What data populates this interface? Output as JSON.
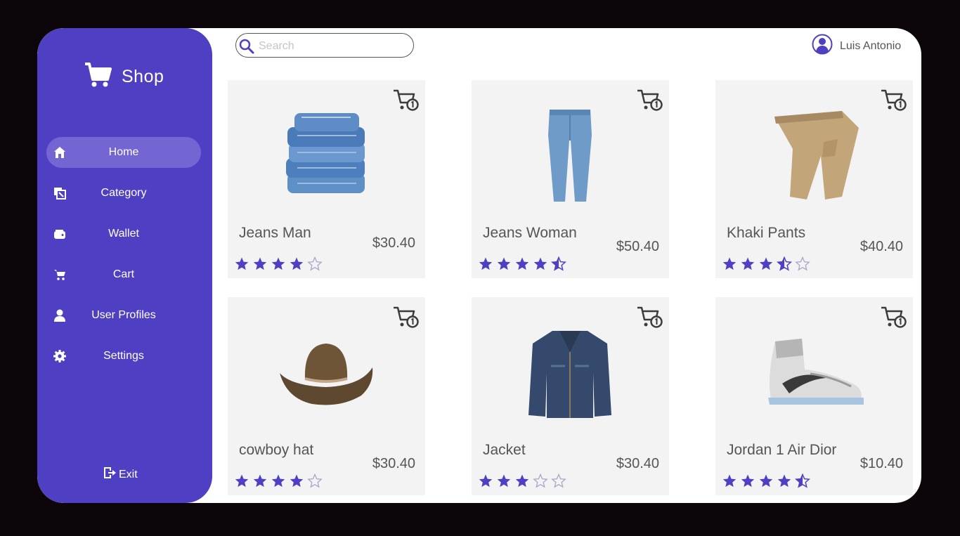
{
  "brand": {
    "label": "Shop"
  },
  "nav": [
    {
      "label": "Home",
      "icon": "home-icon",
      "active": true
    },
    {
      "label": "Category",
      "icon": "category-icon",
      "active": false
    },
    {
      "label": "Wallet",
      "icon": "wallet-icon",
      "active": false
    },
    {
      "label": "Cart",
      "icon": "cart-icon",
      "active": false
    },
    {
      "label": "User Profiles",
      "icon": "user-icon",
      "active": false
    },
    {
      "label": "Settings",
      "icon": "gear-icon",
      "active": false
    }
  ],
  "exit": {
    "label": "Exit"
  },
  "search": {
    "placeholder": "Search",
    "value": ""
  },
  "user": {
    "name": "Luis Antonio"
  },
  "colors": {
    "accent": "#4f3fc2",
    "active_nav": "#7366d3",
    "card_bg": "#f3f3f3"
  },
  "products": [
    {
      "name": "Jeans Man",
      "price": "$30.40",
      "rating": 4,
      "image": "folded-jeans-image"
    },
    {
      "name": "Jeans Woman",
      "price": "$50.40",
      "rating": 4.5,
      "image": "womens-jeans-image"
    },
    {
      "name": "Khaki Pants",
      "price": "$40.40",
      "rating": 3.5,
      "image": "khaki-pants-image"
    },
    {
      "name": "cowboy hat",
      "price": "$30.40",
      "rating": 4,
      "image": "cowboy-hat-image"
    },
    {
      "name": "Jacket",
      "price": "$30.40",
      "rating": 3,
      "image": "denim-jacket-image"
    },
    {
      "name": "Jordan 1 Air Dior",
      "price": "$10.40",
      "rating": 4.5,
      "image": "sneaker-image"
    }
  ]
}
